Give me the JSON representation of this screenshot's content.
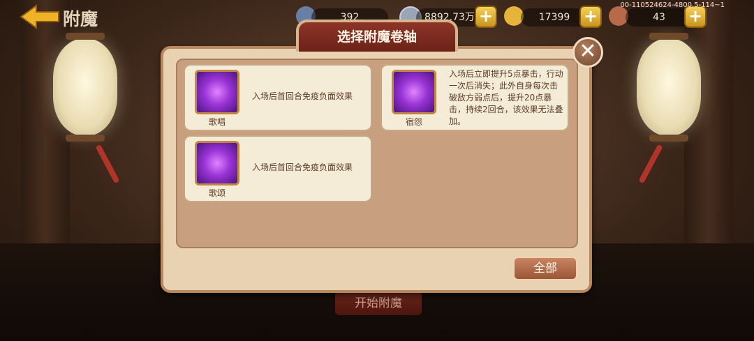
{
  "header": {
    "page_title": "附魔",
    "resources": [
      {
        "icon": "bone-icon",
        "value": "392"
      },
      {
        "icon": "coin-icon",
        "value": "8892.73万"
      },
      {
        "icon": "gold-ingot-icon",
        "value": "17399"
      },
      {
        "icon": "meat-icon",
        "value": "43"
      }
    ],
    "plus_label": "+",
    "build_id": "00-110524624-4800.5-114~1"
  },
  "dialog": {
    "title": "选择附魔卷轴",
    "close_label": "✕",
    "all_button": "全部",
    "items": [
      {
        "name": "歌唱",
        "desc": "入场后首回合免疫负面效果"
      },
      {
        "name": "宿怨",
        "desc": "入场后立即提升5点暴击，行动一次后消失；此外自身每次击破敌方弱点后，提升20点暴击，持续2回合，该效果无法叠加。"
      },
      {
        "name": "歌颂",
        "desc": "入场后首回合免疫负面效果"
      }
    ]
  },
  "footer": {
    "start_button": "开始附魔"
  },
  "colors": {
    "accent": "#8d3428",
    "card": "#f5ecd8",
    "panel": "#c8a080"
  }
}
